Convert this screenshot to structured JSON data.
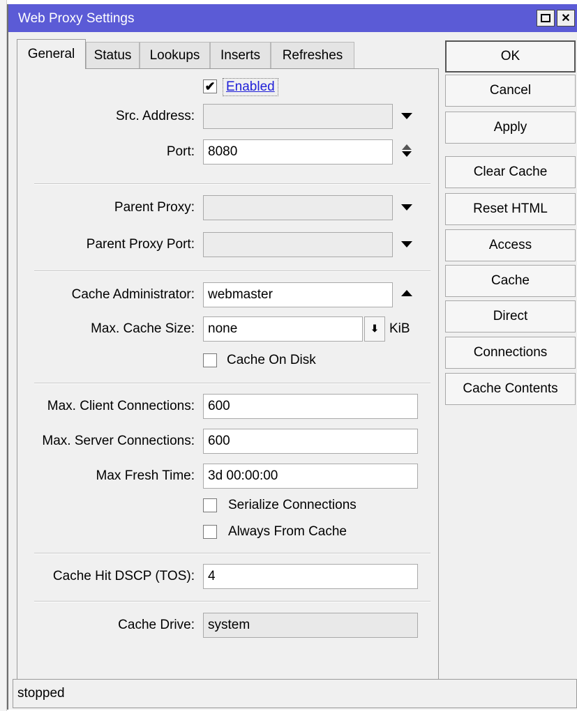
{
  "window": {
    "title": "Web Proxy Settings"
  },
  "tabs": [
    {
      "label": "General",
      "active": true
    },
    {
      "label": "Status"
    },
    {
      "label": "Lookups"
    },
    {
      "label": "Inserts"
    },
    {
      "label": "Refreshes"
    }
  ],
  "general": {
    "enabled": {
      "label": "Enabled",
      "checked": true
    },
    "src_address": {
      "label": "Src. Address:",
      "value": ""
    },
    "port": {
      "label": "Port:",
      "value": "8080"
    },
    "parent_proxy": {
      "label": "Parent Proxy:",
      "value": ""
    },
    "parent_proxy_port": {
      "label": "Parent Proxy Port:",
      "value": ""
    },
    "cache_administrator": {
      "label": "Cache Administrator:",
      "value": "webmaster"
    },
    "max_cache_size": {
      "label": "Max. Cache Size:",
      "value": "none",
      "unit": "KiB"
    },
    "cache_on_disk": {
      "label": "Cache On Disk",
      "checked": false
    },
    "max_client_connections": {
      "label": "Max. Client Connections:",
      "value": "600"
    },
    "max_server_connections": {
      "label": "Max. Server Connections:",
      "value": "600"
    },
    "max_fresh_time": {
      "label": "Max Fresh Time:",
      "value": "3d 00:00:00"
    },
    "serialize_connections": {
      "label": "Serialize Connections",
      "checked": false
    },
    "always_from_cache": {
      "label": "Always From Cache",
      "checked": false
    },
    "cache_hit_dscp": {
      "label": "Cache Hit DSCP (TOS):",
      "value": "4"
    },
    "cache_drive": {
      "label": "Cache Drive:",
      "value": "system"
    }
  },
  "buttons": {
    "ok": "OK",
    "cancel": "Cancel",
    "apply": "Apply",
    "clear_cache": "Clear Cache",
    "reset_html": "Reset HTML",
    "access": "Access",
    "cache": "Cache",
    "direct": "Direct",
    "connections": "Connections",
    "cache_contents": "Cache Contents"
  },
  "status": {
    "text": "stopped"
  },
  "colors": {
    "titlebar": "#5b5bd6",
    "link": "#1f1fd8",
    "window_bg": "#f0f0f0"
  }
}
